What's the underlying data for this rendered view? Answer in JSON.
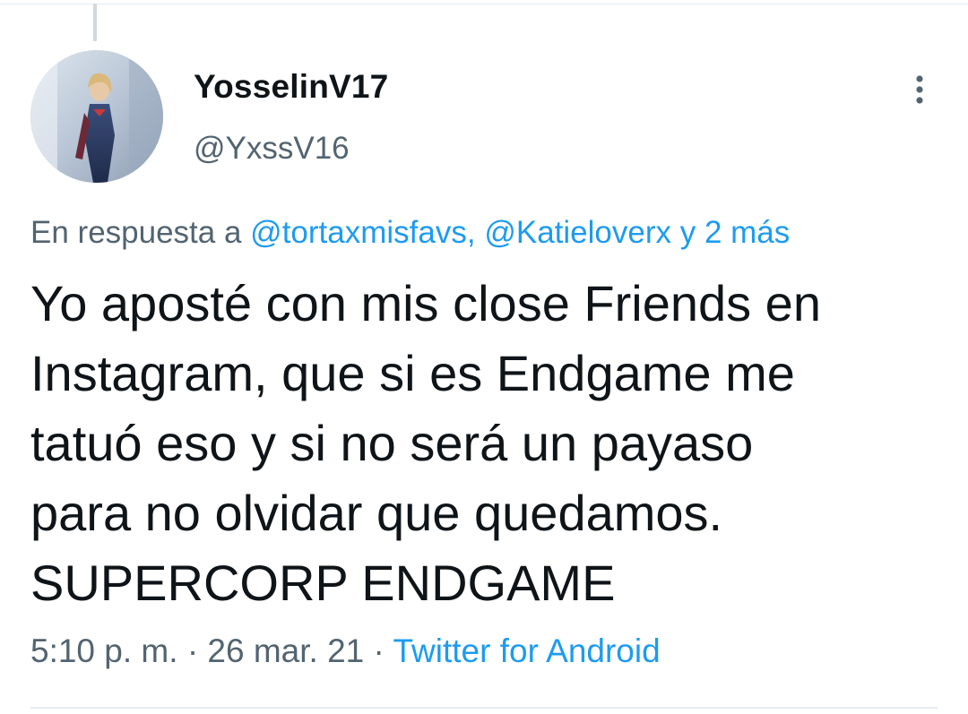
{
  "tweet": {
    "author": {
      "display_name": "YosselinV17",
      "handle": "@YxssV16",
      "avatar_icon": "profile-photo"
    },
    "more_icon": "more-vertical-icon",
    "reply": {
      "prefix": "En respuesta a",
      "mentions": [
        "@tortaxmisfavs",
        "@Katieloverx"
      ],
      "separator": ",",
      "others": "y 2 más"
    },
    "text_lines": [
      "Yo aposté con mis close Friends en",
      "Instagram, que si es Endgame me",
      "tatuó eso y si no será un payaso",
      "para no olvidar que quedamos.",
      "SUPERCORP ENDGAME"
    ],
    "time": "5:10 p. m.",
    "date": "26 mar. 21",
    "dot": "·",
    "source": "Twitter for Android"
  },
  "colors": {
    "text_primary": "#0f1419",
    "text_secondary": "#536471",
    "link": "#1d9bf0",
    "divider": "#e6ecf0"
  }
}
